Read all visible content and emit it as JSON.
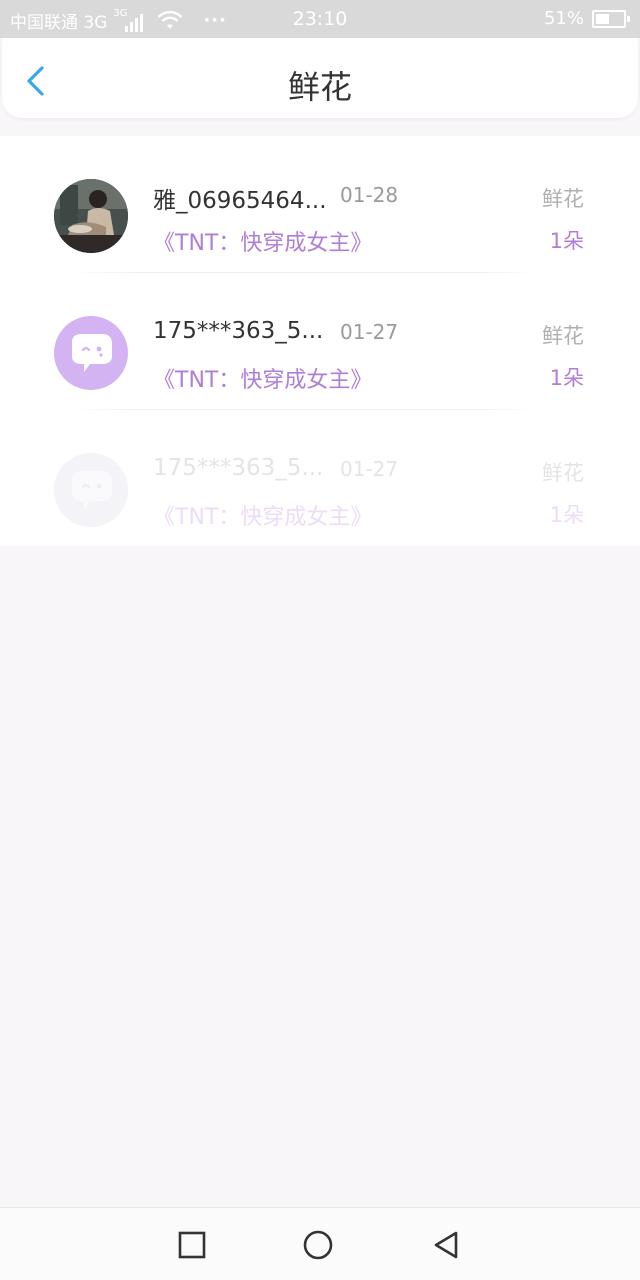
{
  "status_bar": {
    "carrier": "中国联通 3G",
    "network_tag": "3G",
    "dots": "···",
    "time": "23:10",
    "battery": "51%",
    "battery_level": 0.51,
    "icons": [
      "signal-icon",
      "wifi-icon",
      "battery-icon"
    ]
  },
  "header": {
    "title": "鲜花",
    "back_icon": "chevron-left-icon",
    "accent": "#3aa8e8"
  },
  "records": [
    {
      "name": "雅_06965464...",
      "date": "01-28",
      "gift": "鲜花",
      "book": "《TNT：快穿成女主》",
      "count": "1朵",
      "avatar": "photo-avatar"
    },
    {
      "name": "175***363_5...",
      "date": "01-27",
      "gift": "鲜花",
      "book": "《TNT：快穿成女主》",
      "count": "1朵",
      "avatar": "default-avatar"
    },
    {
      "name": "175***363_5...",
      "date": "01-27",
      "gift": "鲜花",
      "book": "《TNT：快穿成女主》",
      "count": "1朵",
      "avatar": "default-avatar"
    }
  ],
  "colors": {
    "accent_purple": "#b07ed8",
    "avatar_purple": "#d4b3f2",
    "background": "#f8f6f8"
  },
  "navbar": {
    "icons": [
      "recent-apps-icon",
      "home-icon",
      "back-icon"
    ]
  }
}
